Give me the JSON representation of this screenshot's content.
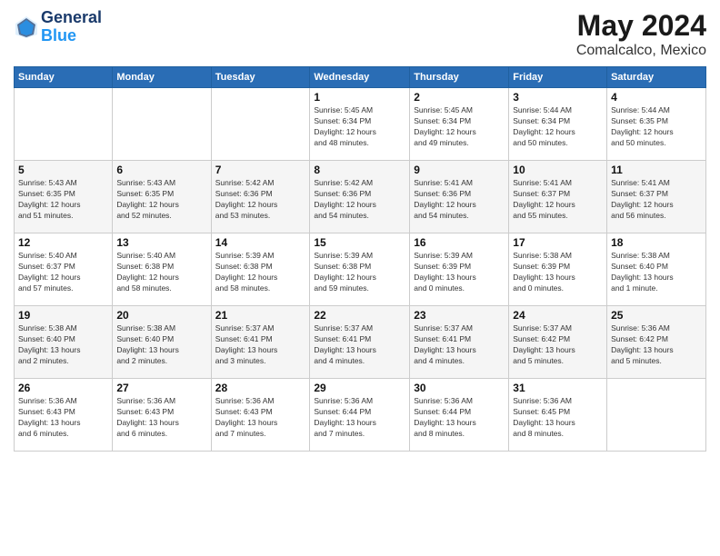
{
  "header": {
    "logo_line1": "General",
    "logo_line2": "Blue",
    "month_year": "May 2024",
    "location": "Comalcalco, Mexico"
  },
  "weekdays": [
    "Sunday",
    "Monday",
    "Tuesday",
    "Wednesday",
    "Thursday",
    "Friday",
    "Saturday"
  ],
  "weeks": [
    [
      {
        "day": "",
        "info": ""
      },
      {
        "day": "",
        "info": ""
      },
      {
        "day": "",
        "info": ""
      },
      {
        "day": "1",
        "info": "Sunrise: 5:45 AM\nSunset: 6:34 PM\nDaylight: 12 hours\nand 48 minutes."
      },
      {
        "day": "2",
        "info": "Sunrise: 5:45 AM\nSunset: 6:34 PM\nDaylight: 12 hours\nand 49 minutes."
      },
      {
        "day": "3",
        "info": "Sunrise: 5:44 AM\nSunset: 6:34 PM\nDaylight: 12 hours\nand 50 minutes."
      },
      {
        "day": "4",
        "info": "Sunrise: 5:44 AM\nSunset: 6:35 PM\nDaylight: 12 hours\nand 50 minutes."
      }
    ],
    [
      {
        "day": "5",
        "info": "Sunrise: 5:43 AM\nSunset: 6:35 PM\nDaylight: 12 hours\nand 51 minutes."
      },
      {
        "day": "6",
        "info": "Sunrise: 5:43 AM\nSunset: 6:35 PM\nDaylight: 12 hours\nand 52 minutes."
      },
      {
        "day": "7",
        "info": "Sunrise: 5:42 AM\nSunset: 6:36 PM\nDaylight: 12 hours\nand 53 minutes."
      },
      {
        "day": "8",
        "info": "Sunrise: 5:42 AM\nSunset: 6:36 PM\nDaylight: 12 hours\nand 54 minutes."
      },
      {
        "day": "9",
        "info": "Sunrise: 5:41 AM\nSunset: 6:36 PM\nDaylight: 12 hours\nand 54 minutes."
      },
      {
        "day": "10",
        "info": "Sunrise: 5:41 AM\nSunset: 6:37 PM\nDaylight: 12 hours\nand 55 minutes."
      },
      {
        "day": "11",
        "info": "Sunrise: 5:41 AM\nSunset: 6:37 PM\nDaylight: 12 hours\nand 56 minutes."
      }
    ],
    [
      {
        "day": "12",
        "info": "Sunrise: 5:40 AM\nSunset: 6:37 PM\nDaylight: 12 hours\nand 57 minutes."
      },
      {
        "day": "13",
        "info": "Sunrise: 5:40 AM\nSunset: 6:38 PM\nDaylight: 12 hours\nand 58 minutes."
      },
      {
        "day": "14",
        "info": "Sunrise: 5:39 AM\nSunset: 6:38 PM\nDaylight: 12 hours\nand 58 minutes."
      },
      {
        "day": "15",
        "info": "Sunrise: 5:39 AM\nSunset: 6:38 PM\nDaylight: 12 hours\nand 59 minutes."
      },
      {
        "day": "16",
        "info": "Sunrise: 5:39 AM\nSunset: 6:39 PM\nDaylight: 13 hours\nand 0 minutes."
      },
      {
        "day": "17",
        "info": "Sunrise: 5:38 AM\nSunset: 6:39 PM\nDaylight: 13 hours\nand 0 minutes."
      },
      {
        "day": "18",
        "info": "Sunrise: 5:38 AM\nSunset: 6:40 PM\nDaylight: 13 hours\nand 1 minute."
      }
    ],
    [
      {
        "day": "19",
        "info": "Sunrise: 5:38 AM\nSunset: 6:40 PM\nDaylight: 13 hours\nand 2 minutes."
      },
      {
        "day": "20",
        "info": "Sunrise: 5:38 AM\nSunset: 6:40 PM\nDaylight: 13 hours\nand 2 minutes."
      },
      {
        "day": "21",
        "info": "Sunrise: 5:37 AM\nSunset: 6:41 PM\nDaylight: 13 hours\nand 3 minutes."
      },
      {
        "day": "22",
        "info": "Sunrise: 5:37 AM\nSunset: 6:41 PM\nDaylight: 13 hours\nand 4 minutes."
      },
      {
        "day": "23",
        "info": "Sunrise: 5:37 AM\nSunset: 6:41 PM\nDaylight: 13 hours\nand 4 minutes."
      },
      {
        "day": "24",
        "info": "Sunrise: 5:37 AM\nSunset: 6:42 PM\nDaylight: 13 hours\nand 5 minutes."
      },
      {
        "day": "25",
        "info": "Sunrise: 5:36 AM\nSunset: 6:42 PM\nDaylight: 13 hours\nand 5 minutes."
      }
    ],
    [
      {
        "day": "26",
        "info": "Sunrise: 5:36 AM\nSunset: 6:43 PM\nDaylight: 13 hours\nand 6 minutes."
      },
      {
        "day": "27",
        "info": "Sunrise: 5:36 AM\nSunset: 6:43 PM\nDaylight: 13 hours\nand 6 minutes."
      },
      {
        "day": "28",
        "info": "Sunrise: 5:36 AM\nSunset: 6:43 PM\nDaylight: 13 hours\nand 7 minutes."
      },
      {
        "day": "29",
        "info": "Sunrise: 5:36 AM\nSunset: 6:44 PM\nDaylight: 13 hours\nand 7 minutes."
      },
      {
        "day": "30",
        "info": "Sunrise: 5:36 AM\nSunset: 6:44 PM\nDaylight: 13 hours\nand 8 minutes."
      },
      {
        "day": "31",
        "info": "Sunrise: 5:36 AM\nSunset: 6:45 PM\nDaylight: 13 hours\nand 8 minutes."
      },
      {
        "day": "",
        "info": ""
      }
    ]
  ]
}
